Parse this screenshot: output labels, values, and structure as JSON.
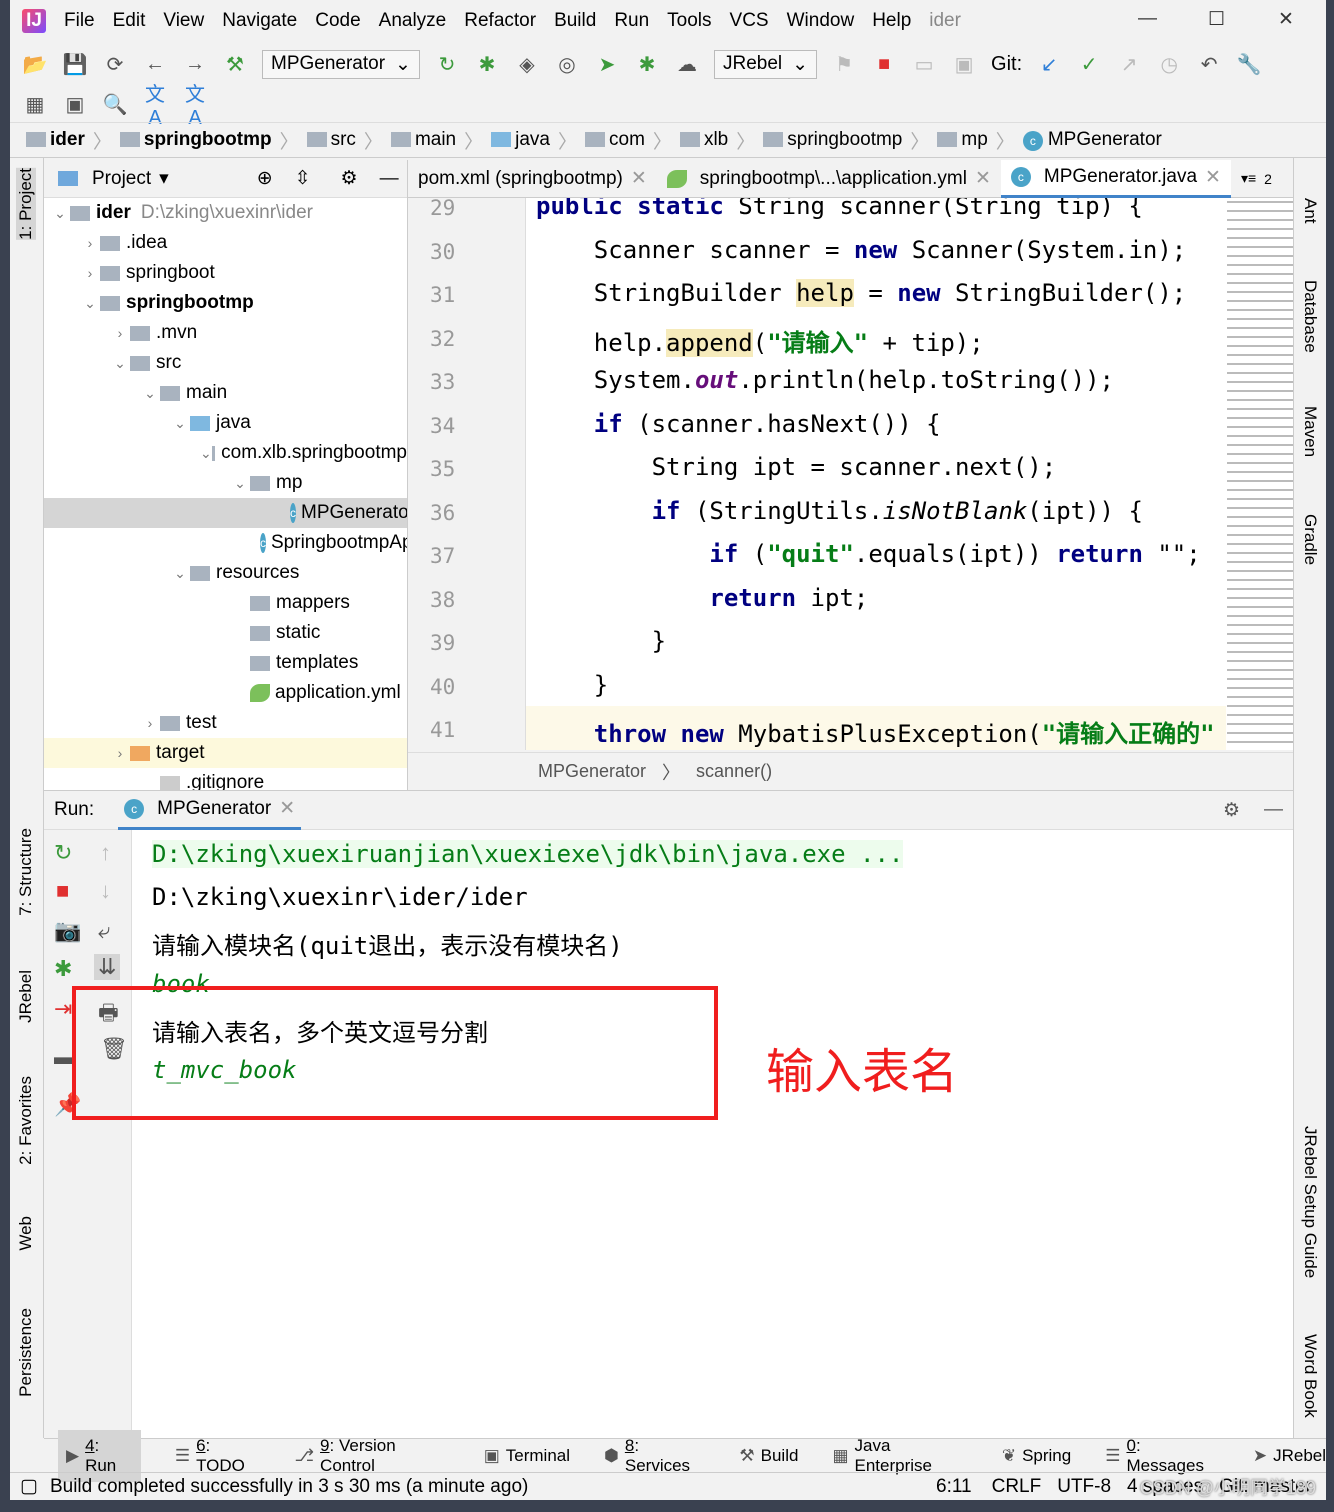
{
  "menu": [
    "File",
    "Edit",
    "View",
    "Navigate",
    "Code",
    "Analyze",
    "Refactor",
    "Build",
    "Run",
    "Tools",
    "VCS",
    "Window",
    "Help"
  ],
  "project_name": "ider",
  "toolbar": {
    "run_config": "MPGenerator",
    "jrebel": "JRebel",
    "git_label": "Git:"
  },
  "breadcrumb": [
    "ider",
    "springbootmp",
    "src",
    "main",
    "java",
    "com",
    "xlb",
    "springbootmp",
    "mp",
    "MPGenerator"
  ],
  "left_stripe": [
    "1: Project",
    "7: Structure",
    "JRebel",
    "2: Favorites",
    "Web",
    "Persistence"
  ],
  "right_stripe": [
    "Ant",
    "Database",
    "Maven",
    "Gradle",
    "JRebel Setup Guide",
    "Word Book"
  ],
  "project_panel": {
    "title": "Project",
    "tree": [
      {
        "label": "ider",
        "extra": "D:\\zking\\xuexinr\\ider",
        "depth": 0,
        "arrow": "v",
        "icon": "folder",
        "bold": true
      },
      {
        "label": ".idea",
        "depth": 1,
        "arrow": ">",
        "icon": "folder"
      },
      {
        "label": "springboot",
        "depth": 1,
        "arrow": ">",
        "icon": "folder"
      },
      {
        "label": "springbootmp",
        "depth": 1,
        "arrow": "v",
        "icon": "folder",
        "bold": true
      },
      {
        "label": ".mvn",
        "depth": 2,
        "arrow": ">",
        "icon": "folder"
      },
      {
        "label": "src",
        "depth": 2,
        "arrow": "v",
        "icon": "folder"
      },
      {
        "label": "main",
        "depth": 3,
        "arrow": "v",
        "icon": "folder"
      },
      {
        "label": "java",
        "depth": 4,
        "arrow": "v",
        "icon": "folder-blue"
      },
      {
        "label": "com.xlb.springbootmp",
        "depth": 5,
        "arrow": "v",
        "icon": "folder"
      },
      {
        "label": "mp",
        "depth": 6,
        "arrow": "v",
        "icon": "folder"
      },
      {
        "label": "MPGenerator",
        "depth": 8,
        "arrow": "",
        "icon": "java-class",
        "selected": true
      },
      {
        "label": "SpringbootmpApplication",
        "depth": 7,
        "arrow": "",
        "icon": "java-class"
      },
      {
        "label": "resources",
        "depth": 4,
        "arrow": "v",
        "icon": "folder"
      },
      {
        "label": "mappers",
        "depth": 6,
        "arrow": "",
        "icon": "folder"
      },
      {
        "label": "static",
        "depth": 6,
        "arrow": "",
        "icon": "folder"
      },
      {
        "label": "templates",
        "depth": 6,
        "arrow": "",
        "icon": "folder"
      },
      {
        "label": "application.yml",
        "depth": 6,
        "arrow": "",
        "icon": "spring-leaf"
      },
      {
        "label": "test",
        "depth": 3,
        "arrow": ">",
        "icon": "folder"
      },
      {
        "label": "target",
        "depth": 2,
        "arrow": ">",
        "icon": "folder-orange",
        "target": true
      },
      {
        "label": ".gitignore",
        "depth": 3,
        "arrow": "",
        "icon": "file"
      }
    ]
  },
  "editor": {
    "tabs": [
      {
        "label": "pom.xml (springbootmp)",
        "active": false
      },
      {
        "label": "springbootmp\\...\\application.yml",
        "active": false
      },
      {
        "label": "MPGenerator.java",
        "active": true
      }
    ],
    "tab_overflow": "2",
    "lines": [
      29,
      30,
      31,
      32,
      33,
      34,
      35,
      36,
      37,
      38,
      39,
      40,
      41
    ],
    "breadcrumb": [
      "MPGenerator",
      "scanner()"
    ]
  },
  "run": {
    "label": "Run:",
    "tab": "MPGenerator",
    "output": [
      "D:\\zking\\xuexiruanjian\\xuexiexe\\jdk\\bin\\java.exe ...",
      "D:\\zking\\xuexinr\\ider/ider",
      "请输入模块名(quit退出，表示没有模块名)",
      "book",
      "请输入表名，多个英文逗号分割",
      "t_mvc_book"
    ]
  },
  "annotation": "输入表名",
  "bottom_tabs": [
    {
      "key": "4",
      "label": ": Run"
    },
    {
      "key": "6",
      "label": ": TODO"
    },
    {
      "key": "9",
      "label": ": Version Control"
    },
    {
      "key": "",
      "label": "Terminal"
    },
    {
      "key": "8",
      "label": ": Services"
    },
    {
      "key": "",
      "label": "Build"
    },
    {
      "key": "",
      "label": "Java Enterprise"
    },
    {
      "key": "",
      "label": "Spring"
    },
    {
      "key": "0",
      "label": ": Messages"
    },
    {
      "key": "",
      "label": "JRebel"
    }
  ],
  "status": {
    "message": "Build completed successfully in 3 s 30 ms (a minute ago)",
    "position": "6:11",
    "line_sep": "CRLF",
    "encoding": "UTF-8",
    "indent": "4 spaces",
    "git": "Git: master",
    "watermark": "CSDN @小明同学189"
  },
  "colors": {
    "accent": "#4083c9",
    "annotation": "#f01e1e",
    "keyword": "#000080",
    "string": "#067d17"
  }
}
